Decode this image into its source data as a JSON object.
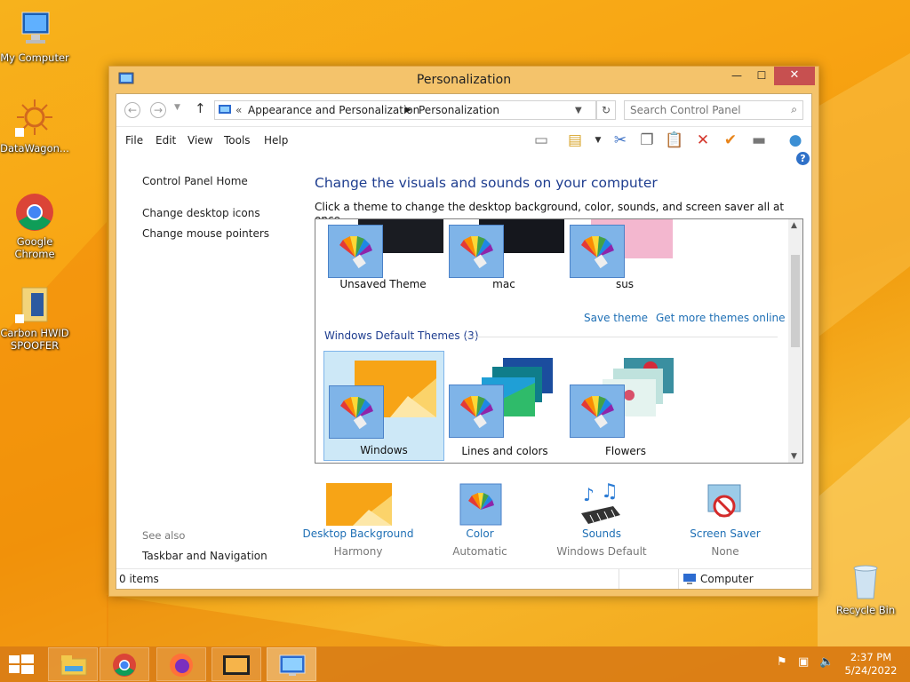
{
  "colors": {
    "accent_link": "#1e6fb5",
    "heading": "#1e3d8f",
    "close_button": "#c75050",
    "desktop": "#f7a817"
  },
  "desktop": {
    "icons": [
      {
        "label": "My Computer",
        "icon": "computer-icon"
      },
      {
        "label": "DataWagon...",
        "icon": "sun-app-icon"
      },
      {
        "label": "Google Chrome",
        "icon": "chrome-icon"
      },
      {
        "label": "Carbon HWID SPOOFER",
        "icon": "folder-icon"
      },
      {
        "label": "Recycle Bin",
        "icon": "recycle-bin-icon"
      }
    ]
  },
  "window": {
    "title": "Personalization",
    "controls": {
      "minimize": "—",
      "maximize": "☐",
      "close": "✕"
    },
    "breadcrumb": {
      "prefix": "«",
      "items": [
        "Appearance and Personalization",
        "Personalization"
      ]
    },
    "search_placeholder": "Search Control Panel",
    "menu": [
      "File",
      "Edit",
      "View",
      "Tools",
      "Help"
    ],
    "left_pane": {
      "home": "Control Panel Home",
      "links": [
        "Change desktop icons",
        "Change mouse pointers"
      ],
      "see_also_title": "See also",
      "see_also": [
        "Taskbar and Navigation"
      ]
    },
    "main": {
      "heading": "Change the visuals and sounds on your computer",
      "instruction": "Click a theme to change the desktop background, color, sounds, and screen saver all at once.",
      "my_themes": [
        "Unsaved Theme",
        "mac",
        "sus"
      ],
      "save_theme": "Save theme",
      "get_more": "Get more themes online",
      "default_group": "Windows Default Themes (3)",
      "default_themes": [
        "Windows",
        "Lines and colors",
        "Flowers"
      ],
      "selected_theme": "Windows"
    },
    "bottom": [
      {
        "caption": "Desktop Background",
        "value": "Harmony",
        "icon": "desktop-background-icon"
      },
      {
        "caption": "Color",
        "value": "Automatic",
        "icon": "color-icon"
      },
      {
        "caption": "Sounds",
        "value": "Windows Default",
        "icon": "sounds-icon"
      },
      {
        "caption": "Screen Saver",
        "value": "None",
        "icon": "screen-saver-icon"
      }
    ],
    "status": {
      "items": "0 items",
      "location": "Computer"
    }
  },
  "taskbar": {
    "apps": [
      "file-explorer-icon",
      "chrome-icon",
      "firefox-icon",
      "media-icon",
      "control-panel-icon"
    ],
    "time": "2:37 PM",
    "date": "5/24/2022"
  }
}
